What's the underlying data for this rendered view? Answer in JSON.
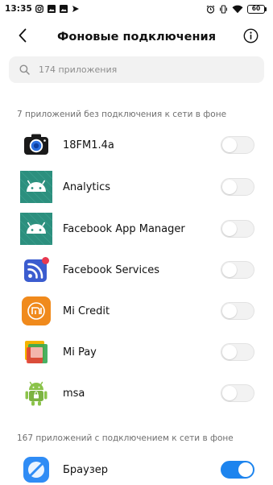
{
  "status_bar": {
    "time": "13:35",
    "left_icons": [
      "instagram-icon",
      "image-icon",
      "image-icon",
      "send-icon"
    ],
    "right_icons": [
      "alarm-icon",
      "vibrate-icon",
      "wifi-icon"
    ],
    "battery": "60"
  },
  "header": {
    "title": "Фоновые подключения",
    "back_icon": "chevron-left-icon",
    "info_icon": "info-circle-icon"
  },
  "search": {
    "placeholder": "174 приложения",
    "icon": "search-icon"
  },
  "sections": [
    {
      "header": "7 приложений без подключения к сети в фоне",
      "apps": [
        {
          "name": "18FM1.4a",
          "icon": "camera-app-icon",
          "enabled": false
        },
        {
          "name": "Analytics",
          "icon": "android-app-icon",
          "enabled": false
        },
        {
          "name": "Facebook App Manager",
          "icon": "android-app-icon",
          "enabled": false
        },
        {
          "name": "Facebook Services",
          "icon": "rss-app-icon",
          "enabled": false
        },
        {
          "name": "Mi Credit",
          "icon": "mi-credit-app-icon",
          "enabled": false
        },
        {
          "name": "Mi Pay",
          "icon": "mi-pay-app-icon",
          "enabled": false
        },
        {
          "name": "msa",
          "icon": "android-lock-app-icon",
          "enabled": false
        }
      ]
    },
    {
      "header": "167 приложений с подключением к сети в фоне",
      "apps": [
        {
          "name": "Браузер",
          "icon": "browser-app-icon",
          "enabled": true
        }
      ]
    }
  ],
  "colors": {
    "accent": "#1d84ee",
    "section_text": "#6f6f6f",
    "search_bg": "#f2f2f2",
    "android_icon_bg": "#2c8f7e"
  }
}
